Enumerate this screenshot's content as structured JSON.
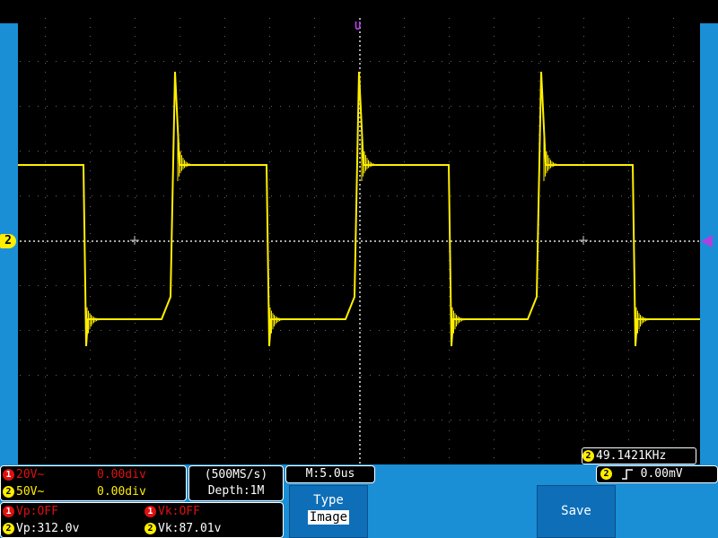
{
  "channels": {
    "ch1": {
      "badge": "1",
      "scale": "20V~",
      "offset": "0.00div"
    },
    "ch2": {
      "badge": "2",
      "scale": "50V~",
      "offset": "0.00div"
    }
  },
  "ch2_marker": "2",
  "acquisition": {
    "sample_rate": "(500MS/s)",
    "depth": "Depth:1M"
  },
  "timebase": "M:5.0us",
  "frequency": {
    "badge": "2",
    "value": "49.1421KHz"
  },
  "trigger": {
    "badge": "2",
    "level": "0.00mV"
  },
  "measurements": {
    "ch1_vp": {
      "badge": "1",
      "text": "Vp:OFF"
    },
    "ch1_vk": {
      "badge": "1",
      "text": "Vk:OFF"
    },
    "ch2_vp": {
      "badge": "2",
      "text": "Vp:312.0v"
    },
    "ch2_vk": {
      "badge": "2",
      "text": "Vk:87.01v"
    }
  },
  "menu": {
    "type_label": "Type",
    "type_value": "Image",
    "save_label": "Save"
  },
  "colors": {
    "waveform": "#ffee00",
    "ch1": "#e01010",
    "ch2": "#ffee00",
    "trigger_marker": "#b040e0",
    "panel_blue": "#1a8fd6"
  },
  "icons": {
    "top_trigger_marker": "U",
    "trigger_edge": "rising-edge-icon"
  }
}
